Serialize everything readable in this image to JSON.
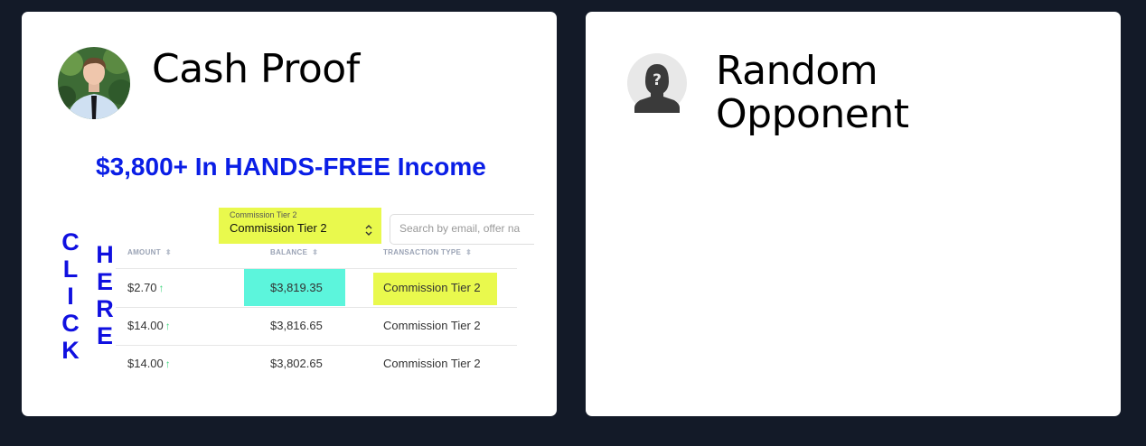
{
  "cards": [
    {
      "title": "Cash Proof",
      "avatar": "profile-photo",
      "promo": {
        "headline": "$3,800+ In HANDS-FREE Income",
        "click_letters": [
          "C",
          "L",
          "I",
          "C",
          "K"
        ],
        "here_letters": [
          "H",
          "E",
          "R",
          "E"
        ],
        "tier_select": {
          "label": "Commission Tier 2",
          "value": "Commission Tier 2"
        },
        "search_placeholder": "Search by email, offer na",
        "columns": [
          "AMOUNT",
          "BALANCE",
          "TRANSACTION TYPE"
        ],
        "rows": [
          {
            "amount": "$2.70",
            "balance": "$3,819.35",
            "type": "Commission Tier 2"
          },
          {
            "amount": "$14.00",
            "balance": "$3,816.65",
            "type": "Commission Tier 2"
          },
          {
            "amount": "$14.00",
            "balance": "$3,802.65",
            "type": "Commission Tier 2"
          }
        ],
        "arrow_glyph": "↑"
      }
    },
    {
      "title": "Random Opponent",
      "avatar": "unknown-user-icon"
    }
  ],
  "colors": {
    "background": "#131a28",
    "card": "#ffffff",
    "headline": "#0a1ee6",
    "highlight_yellow": "#e9f94d",
    "highlight_teal": "#5cf5dc",
    "arrow_green": "#39d57a"
  }
}
